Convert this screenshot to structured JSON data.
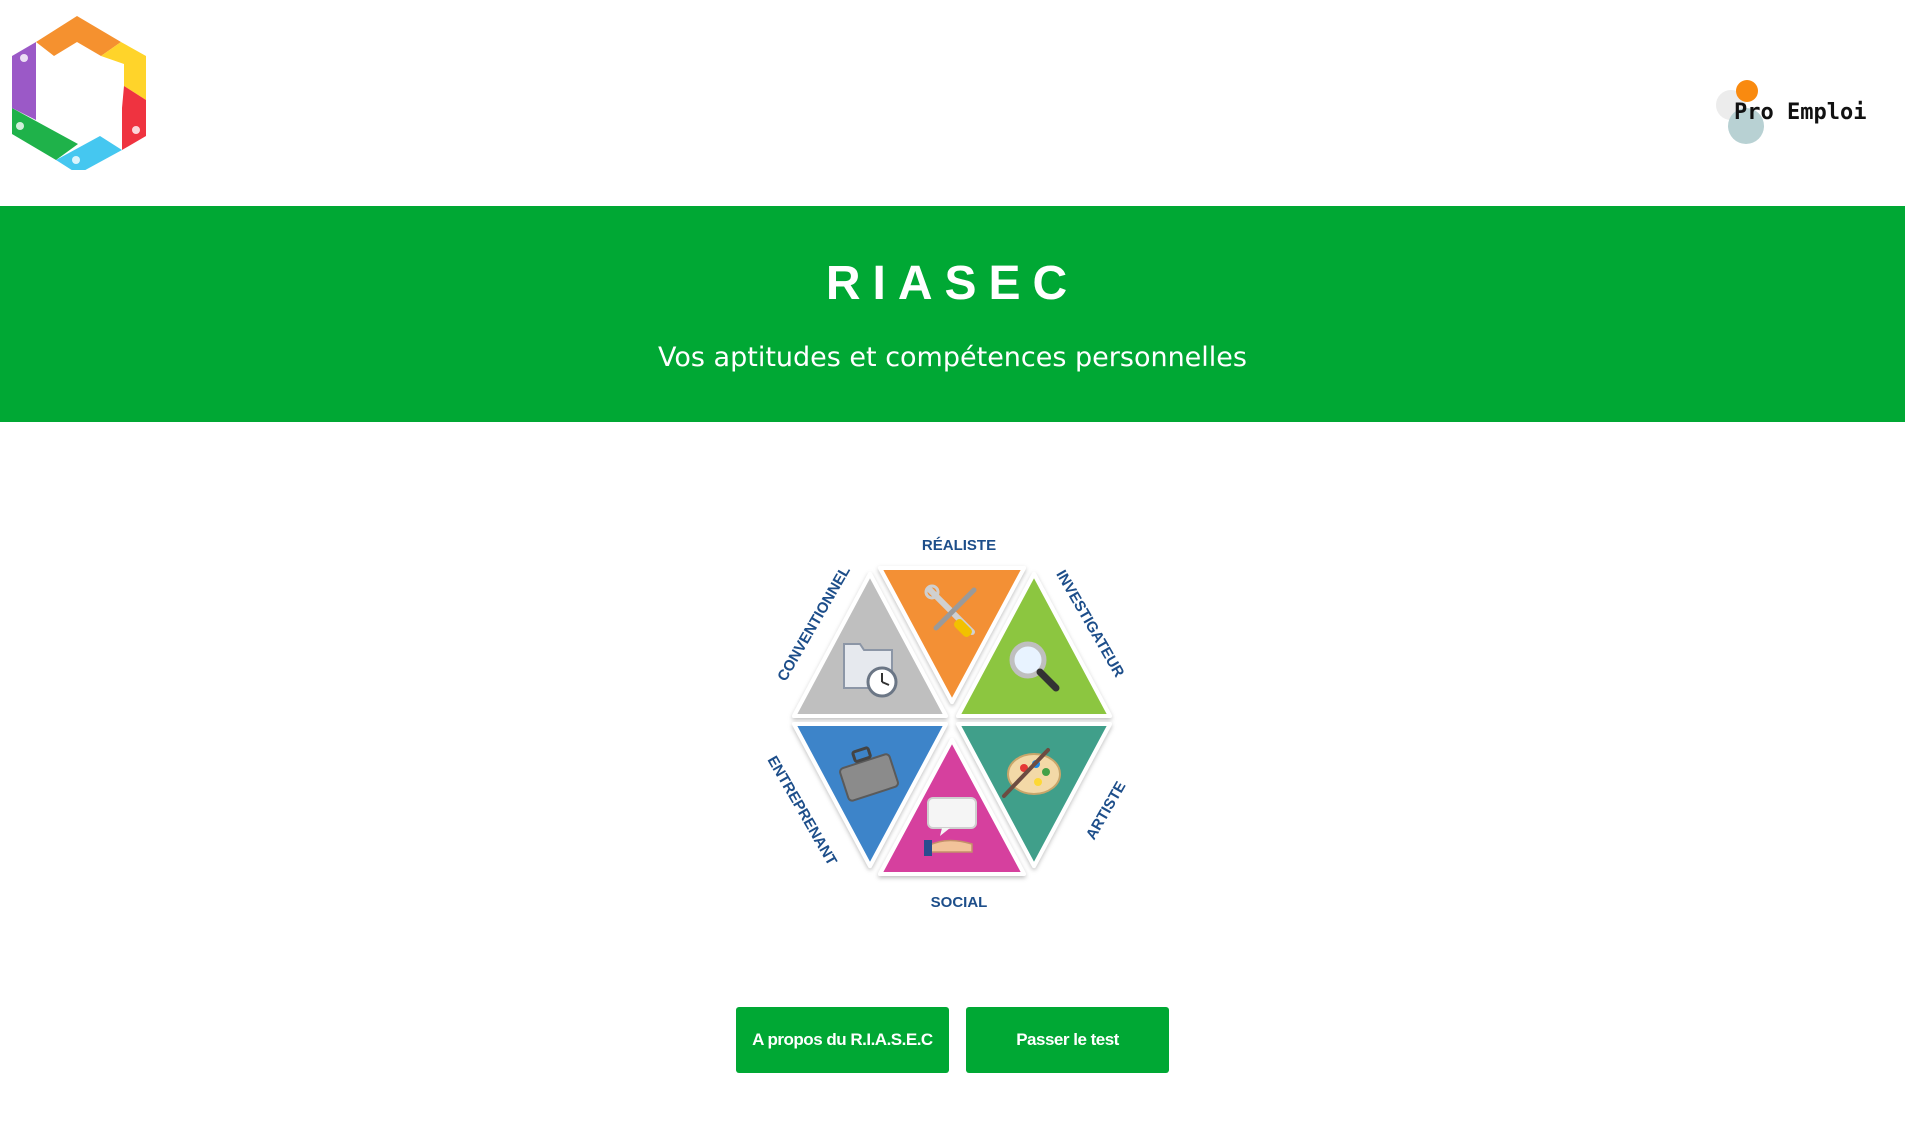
{
  "header": {
    "logo": {
      "icon": "riasec-hexagon-logo",
      "segments": [
        "entreprenant",
        "conventionnel",
        "réaliste",
        "investigateur",
        "artistique",
        "social"
      ]
    },
    "brand": {
      "label": "Pro Emploi",
      "colors": {
        "orange": "#f98a0f",
        "grey": "#b8d1d3",
        "light": "#ececec"
      }
    }
  },
  "hero": {
    "title": "RIASEC",
    "subtitle": "Vos aptitudes et compétences personnelles",
    "background": "#00a834"
  },
  "diagram": {
    "labels": {
      "realiste": "RÉALISTE",
      "investigateur": "INVESTIGATEUR",
      "artiste": "ARTISTE",
      "social": "SOCIAL",
      "entreprenant": "ENTREPRENANT",
      "conventionnel": "CONVENTIONNEL"
    },
    "colors": {
      "realiste": "#f39036",
      "investigateur": "#8cc63f",
      "artiste": "#3f9f8a",
      "social": "#d63f9e",
      "entreprenant": "#3d84c9",
      "conventionnel": "#bfbfbf"
    },
    "icons": {
      "realiste": "tools-icon",
      "investigateur": "magnifier-icon",
      "artiste": "palette-icon",
      "social": "speech-hand-icon",
      "entreprenant": "briefcase-icon",
      "conventionnel": "folder-clock-icon"
    }
  },
  "actions": {
    "about_label": "A propos du R.I.A.S.E.C",
    "test_label": "Passer le test"
  }
}
